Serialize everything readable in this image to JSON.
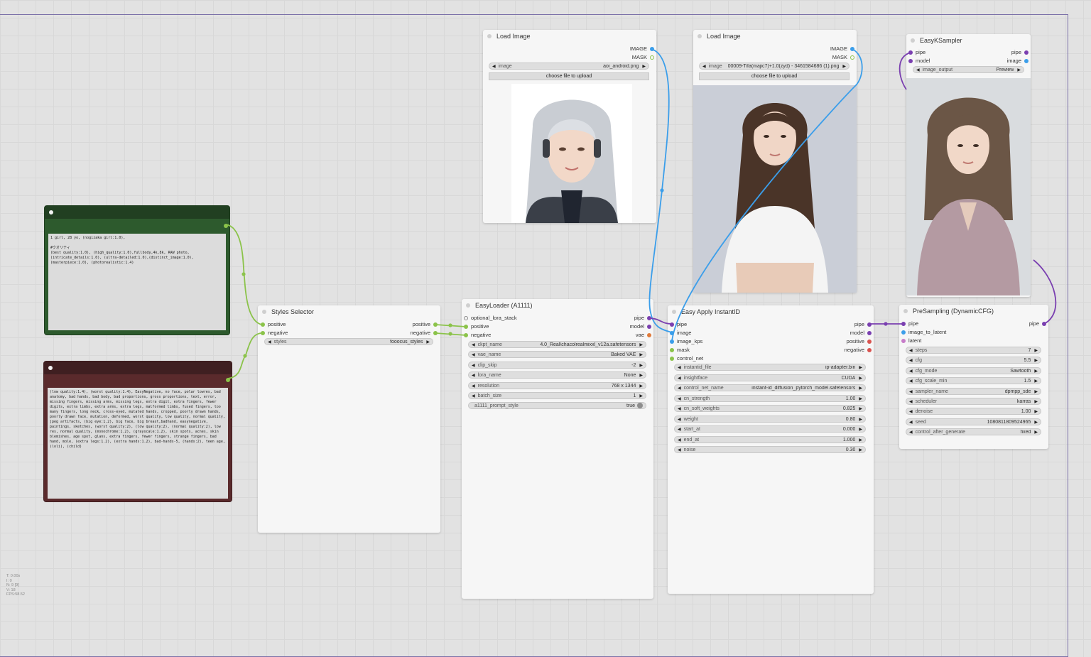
{
  "colors": {
    "link_green": "#8bc34a",
    "link_blue": "#3b9eea",
    "link_purple": "#7a3fb0",
    "positive_node": "#2d5a2d",
    "negative_node": "#5a2a2c",
    "pin_green": "#8bc34a",
    "pin_blue": "#3b9eea",
    "pin_purple": "#7a3fb0",
    "pin_red": "#d9534f",
    "pin_orange": "#e07a3a"
  },
  "positive_prompt": {
    "text": "1 girl, 28 yo, (nogizaka girl:1.0),\n\n#クオリティ\n(best quality:1.0), (high_quality:1.0),fullbody,4k,8k, RAW photo,(intricate_details:1.0), (ultra-detailed:1.0),(distinct_image:1.0),(masterpiece:1.0), (photorealistic:1.4)"
  },
  "negative_prompt": {
    "text": "(low quality:1.4), (worst quality:1.4), EasyNegative, no face, polar lowres, bad anatomy, bad hands, bad body, bad proportions, gross proportions, text, error, missing fingers, missing arms, missing legs, extra digit, extra fingers, fewer digits, extra limbs, extra arms, extra legs, malformed limbs, fused fingers, too many fingers, long neck, cross-eyed, mutated hands, cropped, poorly drawn hands, poorly drawn face, mutation, deformed, worst quality, low quality, normal quality, jpeg artifacts, (big eye:1.2), big face, big breast,badhand, easynegative, paintings, sketches, (worst quality:2), (low quality:2), (normal quality:2), low res, normal quality, (monochrome:1.2), (grayscale:1.2), skin spots, acnes, skin blemishes, age spot, glans, extra fingers, fewer fingers, strange fingers, bad hand, mole, (extra legs:1.2), (extra hands:1.2), bad-hands-5, (hands:2), teen age, (loli), (child)"
  },
  "styles_selector": {
    "title": "Styles Selector",
    "inputs": [
      "positive",
      "negative"
    ],
    "outputs": [
      "positive",
      "negative"
    ],
    "widget_name": "styles",
    "widget_value": "fooocus_styles"
  },
  "load_image_1": {
    "title": "Load Image",
    "outputs": [
      "IMAGE",
      "MASK"
    ],
    "image_label": "image",
    "image_value": "aoi_android.png",
    "upload_label": "choose file to upload"
  },
  "load_image_2": {
    "title": "Load Image",
    "outputs": [
      "IMAGE",
      "MASK"
    ],
    "image_label": "image",
    "image_value": "00009-Tifa(majic7)+1.0(zyd) - 3461584686 (1).png",
    "upload_label": "choose file to upload"
  },
  "easy_loader": {
    "title": "EasyLoader (A1111)",
    "inputs": [
      "optional_lora_stack",
      "positive",
      "negative"
    ],
    "outputs": [
      "pipe",
      "model",
      "vae"
    ],
    "widgets": [
      {
        "name": "ckpt_name",
        "value": "4.0_Real\\chacolrealmixxl_v12a.safetensors"
      },
      {
        "name": "vae_name",
        "value": "Baked VAE"
      },
      {
        "name": "clip_skip",
        "value": "-2"
      },
      {
        "name": "lora_name",
        "value": "None"
      },
      {
        "name": "resolution",
        "value": "768 x 1344"
      },
      {
        "name": "batch_size",
        "value": "1"
      }
    ],
    "toggle": {
      "name": "a1111_prompt_style",
      "value": "true"
    }
  },
  "instantid": {
    "title": "Easy Apply InstantID",
    "inputs": [
      "pipe",
      "image",
      "image_kps",
      "mask",
      "control_net"
    ],
    "outputs": [
      "pipe",
      "model",
      "positive",
      "negative"
    ],
    "widgets": [
      {
        "name": "instantid_file",
        "value": "ip-adapter.bin"
      },
      {
        "name": "insightface",
        "value": "CUDA"
      },
      {
        "name": "control_net_name",
        "value": "instant-id_diffusion_pytorch_model.safetensors"
      },
      {
        "name": "cn_strength",
        "value": "1.00"
      },
      {
        "name": "cn_soft_weights",
        "value": "0.825"
      },
      {
        "name": "weight",
        "value": "0.80"
      },
      {
        "name": "start_at",
        "value": "0.000"
      },
      {
        "name": "end_at",
        "value": "1.000"
      },
      {
        "name": "noise",
        "value": "0.30"
      }
    ]
  },
  "ksampler": {
    "title": "EasyKSampler",
    "inputs": [
      "pipe",
      "model"
    ],
    "outputs": [
      "pipe",
      "image"
    ],
    "widget_name": "image_output",
    "widget_value": "Preview"
  },
  "presampling": {
    "title": "PreSampling (DynamicCFG)",
    "inputs": [
      "pipe",
      "image_to_latent",
      "latent"
    ],
    "outputs": [
      "pipe"
    ],
    "widgets": [
      {
        "name": "steps",
        "value": "7"
      },
      {
        "name": "cfg",
        "value": "5.5"
      },
      {
        "name": "cfg_mode",
        "value": "Sawtooth"
      },
      {
        "name": "cfg_scale_min",
        "value": "1.5"
      },
      {
        "name": "sampler_name",
        "value": "dpmpp_sde"
      },
      {
        "name": "scheduler",
        "value": "karras"
      },
      {
        "name": "denoise",
        "value": "1.00"
      },
      {
        "name": "seed",
        "value": "1080811809524965"
      },
      {
        "name": "control_after_generate",
        "value": "fixed"
      }
    ]
  },
  "stats": [
    "T: 0.00s",
    "I: 0",
    "N: 9 [9]",
    "V: 18",
    "FPS:58.52"
  ]
}
